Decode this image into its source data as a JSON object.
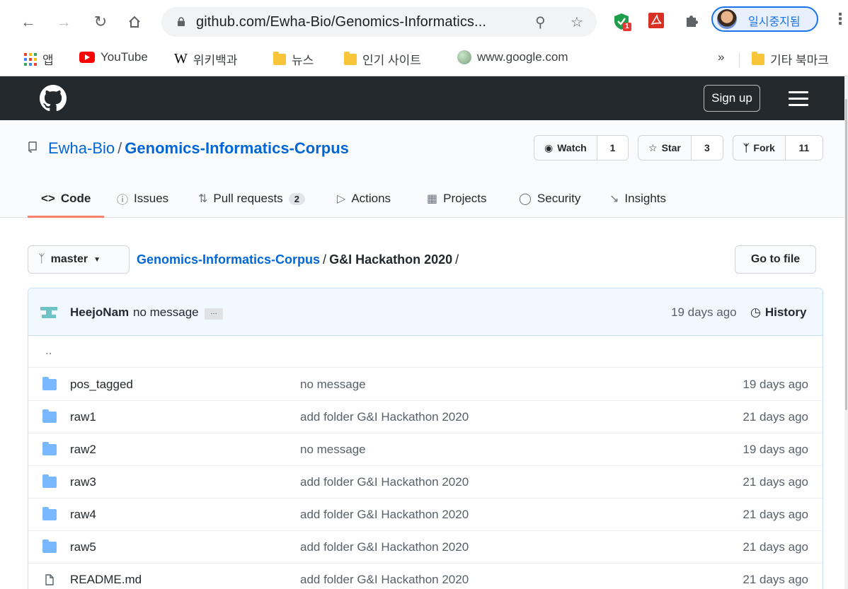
{
  "browser": {
    "url": "github.com/Ewha-Bio/Genomics-Informatics...",
    "profile_label": "일시중지됨",
    "extension_badge": "1",
    "bookmarks": [
      {
        "label": "앱",
        "icon": "apps-icon"
      },
      {
        "label": "YouTube",
        "icon": "youtube-icon"
      },
      {
        "label": "위키백과",
        "icon": "wikipedia-icon"
      },
      {
        "label": "뉴스",
        "icon": "folder-icon"
      },
      {
        "label": "인기 사이트",
        "icon": "folder-icon"
      },
      {
        "label": "www.google.com",
        "icon": "globe-icon"
      }
    ],
    "overflow_label": "»",
    "other_bookmarks": "기타 북마크"
  },
  "github": {
    "signup_label": "Sign up",
    "owner": "Ewha-Bio",
    "repo": "Genomics-Informatics-Corpus",
    "watch_label": "Watch",
    "watch_count": "1",
    "star_label": "Star",
    "star_count": "3",
    "fork_label": "Fork",
    "fork_count": "11",
    "tabs": [
      {
        "label": "Code",
        "icon": "code-icon"
      },
      {
        "label": "Issues",
        "icon": "issue-icon"
      },
      {
        "label": "Pull requests",
        "icon": "pull-request-icon",
        "counter": "2"
      },
      {
        "label": "Actions",
        "icon": "play-icon"
      },
      {
        "label": "Projects",
        "icon": "project-icon"
      },
      {
        "label": "Security",
        "icon": "shield-icon"
      },
      {
        "label": "Insights",
        "icon": "graph-icon"
      }
    ]
  },
  "filenav": {
    "branch": "master",
    "crumb_repo": "Genomics-Informatics-Corpus",
    "crumb_dir": "G&I Hackathon 2020",
    "goto_label": "Go to file"
  },
  "commit": {
    "author": "HeejoNam",
    "message": "no message",
    "ellipsis": "…",
    "age": "19 days ago",
    "history_label": "History"
  },
  "parent_dir": "..",
  "files": [
    {
      "name": "pos_tagged",
      "type": "dir",
      "message": "no message",
      "age": "19 days ago"
    },
    {
      "name": "raw1",
      "type": "dir",
      "message": "add folder G&I Hackathon 2020",
      "age": "21 days ago"
    },
    {
      "name": "raw2",
      "type": "dir",
      "message": "no message",
      "age": "19 days ago"
    },
    {
      "name": "raw3",
      "type": "dir",
      "message": "add folder G&I Hackathon 2020",
      "age": "21 days ago"
    },
    {
      "name": "raw4",
      "type": "dir",
      "message": "add folder G&I Hackathon 2020",
      "age": "21 days ago"
    },
    {
      "name": "raw5",
      "type": "dir",
      "message": "add folder G&I Hackathon 2020",
      "age": "21 days ago"
    },
    {
      "name": "README.md",
      "type": "file",
      "message": "add folder G&I Hackathon 2020",
      "age": "21 days ago"
    }
  ],
  "colors": {
    "link": "#0366d6",
    "header_bg": "#24292e",
    "tab_underline": "#f9826c",
    "folder": "#79b8ff"
  }
}
